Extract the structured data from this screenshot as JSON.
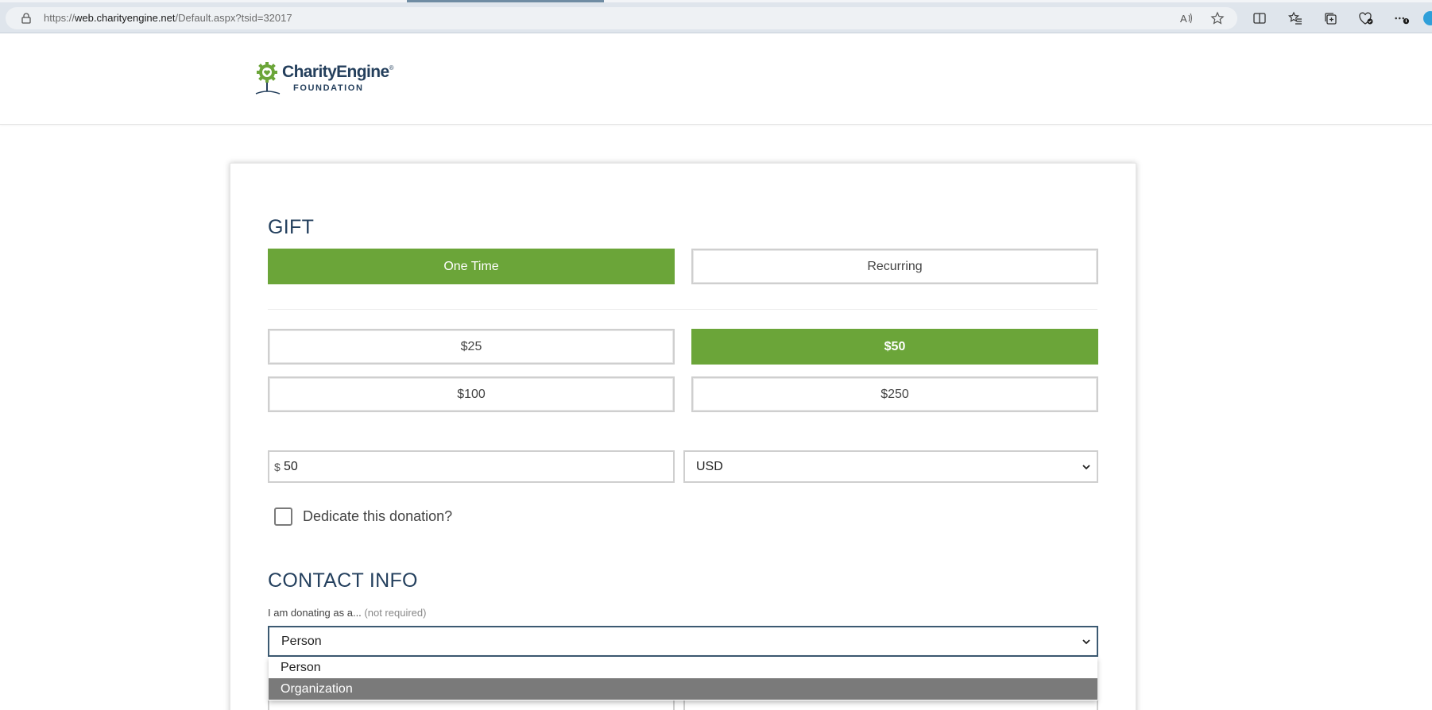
{
  "browser": {
    "url_prefix": "https://",
    "url_domain": "web.charityengine.net",
    "url_path": "/Default.aspx?tsid=32017",
    "icons": [
      "lock-icon",
      "read-aloud-icon",
      "favorite-star-icon",
      "split-screen-icon",
      "favorites-icon",
      "collections-icon",
      "browser-essentials-icon",
      "more-icon"
    ]
  },
  "header": {
    "logo_name": "CharityEngine",
    "logo_registered": "®",
    "logo_sub": "FOUNDATION"
  },
  "gift": {
    "title": "GIFT",
    "frequency": [
      {
        "label": "One Time",
        "selected": true
      },
      {
        "label": "Recurring",
        "selected": false
      }
    ],
    "amounts": [
      {
        "label": "$25",
        "selected": false
      },
      {
        "label": "$50",
        "selected": true
      },
      {
        "label": "$100",
        "selected": false
      },
      {
        "label": "$250",
        "selected": false
      }
    ],
    "currency_symbol": "$",
    "amount_value": "50",
    "currency": "USD",
    "dedicate_label": "Dedicate this donation?"
  },
  "contact": {
    "title": "CONTACT INFO",
    "donor_type_label": "I am donating as a...",
    "donor_type_hint": "(not required)",
    "donor_type_value": "Person",
    "donor_type_options": [
      {
        "label": "Person",
        "highlighted": false
      },
      {
        "label": "Organization",
        "highlighted": true
      }
    ]
  },
  "colors": {
    "accent_green": "#6ba539",
    "heading_navy": "#24405e",
    "highlight_gray": "#7a7a7a"
  }
}
